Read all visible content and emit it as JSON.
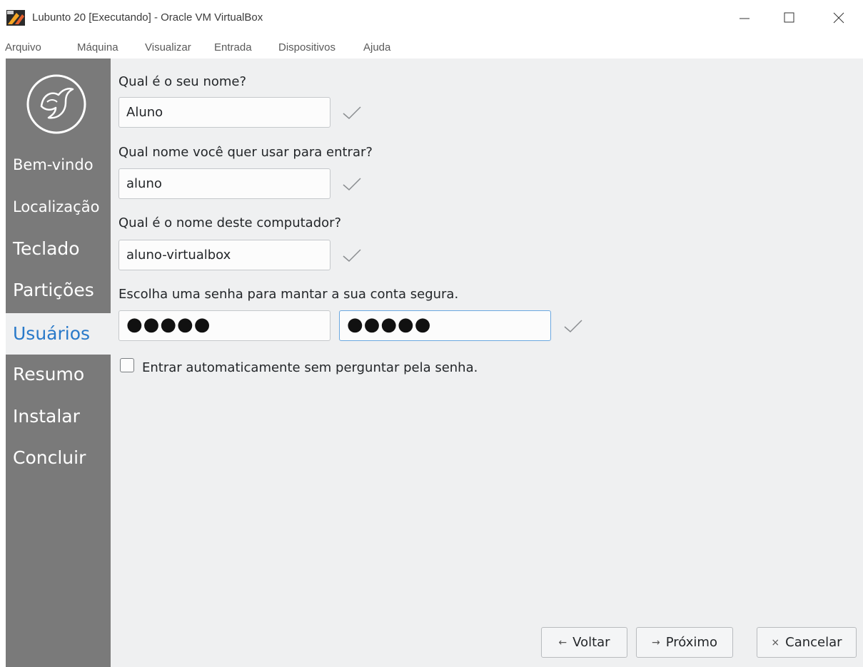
{
  "window": {
    "title": "Lubunto 20 [Executando] - Oracle VM VirtualBox",
    "app_icon": "virtualbox-icon"
  },
  "menubar": {
    "items": [
      "Arquivo",
      "Máquina",
      "Visualizar",
      "Entrada",
      "Dispositivos",
      "Ajuda"
    ]
  },
  "sidebar": {
    "logo": "lubuntu-bird-logo",
    "steps": [
      {
        "label": "Bem-vindo",
        "active": false
      },
      {
        "label": "Localização",
        "active": false
      },
      {
        "label": "Teclado",
        "active": false
      },
      {
        "label": "Partições",
        "active": false
      },
      {
        "label": "Usuários",
        "active": true
      },
      {
        "label": "Resumo",
        "active": false
      },
      {
        "label": "Instalar",
        "active": false
      },
      {
        "label": "Concluir",
        "active": false
      }
    ]
  },
  "form": {
    "name_label": "Qual é o seu nome?",
    "name_value": "Aluno",
    "login_label": "Qual nome você quer usar para entrar?",
    "login_value": "aluno",
    "hostname_label": "Qual é o nome deste computador?",
    "hostname_value": "aluno-virtualbox",
    "password_label": "Escolha uma senha para mantar a sua conta segura.",
    "password_value": "●●●●●",
    "password_confirm_value": "●●●●●",
    "autologin_label": "Entrar automaticamente sem perguntar pela senha.",
    "autologin_checked": false
  },
  "buttons": {
    "back": "Voltar",
    "next": "Próximo",
    "cancel": "Cancelar"
  },
  "colors": {
    "sidebar_bg": "#7a7a7a",
    "active_step": "#2979c9",
    "content_bg": "#eff0f1",
    "focus_border": "#6ba8e0"
  }
}
